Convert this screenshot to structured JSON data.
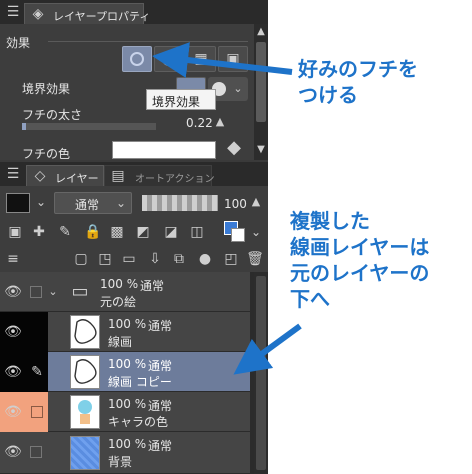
{
  "layer_property": {
    "tab_title": "レイヤープロパティ",
    "section_effect": "効果",
    "border_effect_label": "境界効果",
    "tooltip": "境界効果",
    "border_width_label": "フチの太さ",
    "border_width_value": "0.22",
    "border_color_label": "フチの色"
  },
  "layer_panel": {
    "tab_layer": "レイヤー",
    "tab_auto_action": "オートアクション",
    "blend_mode": "通常",
    "opacity": "100",
    "layers": [
      {
        "percent": "100 %",
        "mode": "通常",
        "name": "元の絵",
        "type": "folder"
      },
      {
        "percent": "100 %",
        "mode": "通常",
        "name": "線画",
        "type": "raster"
      },
      {
        "percent": "100 %",
        "mode": "通常",
        "name": "線画 コピー",
        "type": "raster",
        "selected": true
      },
      {
        "percent": "100 %",
        "mode": "通常",
        "name": "キャラの色",
        "type": "raster"
      },
      {
        "percent": "100 %",
        "mode": "通常",
        "name": "背景",
        "type": "fill"
      }
    ]
  },
  "annotations": {
    "top": [
      "好みのフチを",
      "つける"
    ],
    "bottom": [
      "複製した",
      "線画レイヤーは",
      "元のレイヤーの",
      "下へ"
    ]
  },
  "colors": {
    "annotation": "#1e73c9",
    "selected_row": "#6d7c9b",
    "orange_cell": "#f2a27e"
  }
}
